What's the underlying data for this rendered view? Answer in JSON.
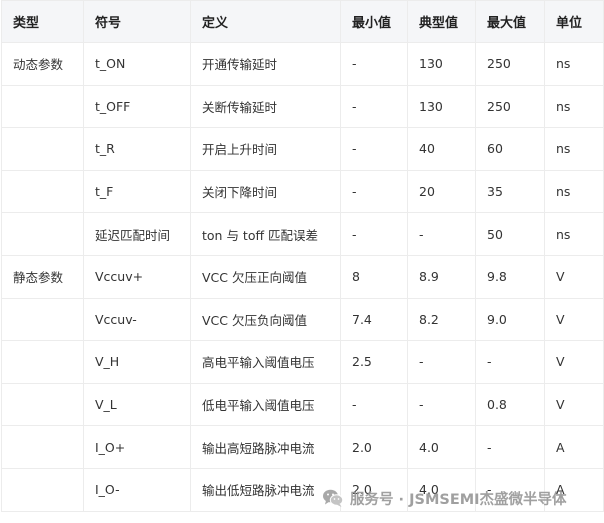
{
  "table": {
    "headers": [
      "类型",
      "符号",
      "定义",
      "最小值",
      "典型值",
      "最大值",
      "单位"
    ],
    "rows": [
      [
        "动态参数",
        "t_ON",
        "开通传输延时",
        "-",
        "130",
        "250",
        "ns"
      ],
      [
        "",
        "t_OFF",
        "关断传输延时",
        "-",
        "130",
        "250",
        "ns"
      ],
      [
        "",
        "t_R",
        "开启上升时间",
        "-",
        "40",
        "60",
        "ns"
      ],
      [
        "",
        "t_F",
        "关闭下降时间",
        "-",
        "20",
        "35",
        "ns"
      ],
      [
        "",
        "延迟匹配时间",
        "ton 与 toff 匹配误差",
        "-",
        "-",
        "50",
        "ns"
      ],
      [
        "静态参数",
        "Vccuv+",
        "VCC 欠压正向阈值",
        "8",
        "8.9",
        "9.8",
        "V"
      ],
      [
        "",
        "Vccuv-",
        "VCC 欠压负向阈值",
        "7.4",
        "8.2",
        "9.0",
        "V"
      ],
      [
        "",
        "V_H",
        "高电平输入阈值电压",
        "2.5",
        "-",
        "-",
        "V"
      ],
      [
        "",
        "V_L",
        "低电平输入阈值电压",
        "-",
        "-",
        "0.8",
        "V"
      ],
      [
        "",
        "I_O+",
        "输出高短路脉冲电流",
        "2.0",
        "4.0",
        "-",
        "A"
      ],
      [
        "",
        "I_O-",
        "输出低短路脉冲电流",
        "2.0",
        "4.0",
        "-",
        "A"
      ]
    ]
  },
  "watermark": {
    "text": "服务号 · JSMSEMI杰盛微半导体",
    "icon": "wechat-icon"
  }
}
